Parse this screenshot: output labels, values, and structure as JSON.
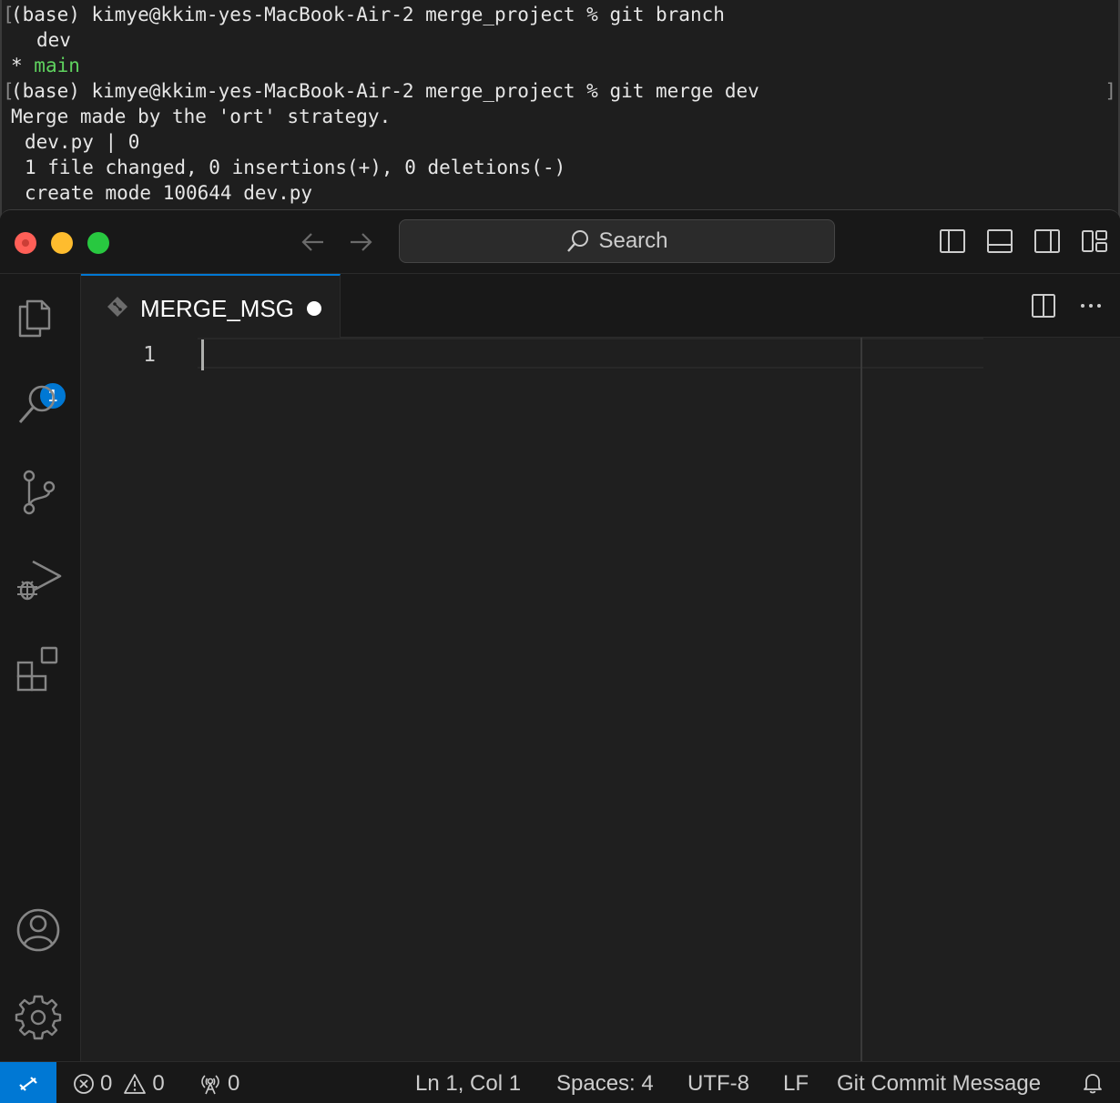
{
  "terminal": {
    "lines": [
      {
        "prompt": "(base) kimye@kkim-yes-MacBook-Air-2 merge_project % ",
        "command": "git branch"
      },
      {
        "text": "dev"
      },
      {
        "marker": "* ",
        "text": "main"
      },
      {
        "prompt": "(base) kimye@kkim-yes-MacBook-Air-2 merge_project % ",
        "command": "git merge dev"
      },
      {
        "text": "Merge made by the 'ort' strategy."
      },
      {
        "text": "dev.py | 0"
      },
      {
        "text": "1 file changed, 0 insertions(+), 0 deletions(-)"
      },
      {
        "text": "create mode 100644 dev.py"
      }
    ]
  },
  "titlebar": {
    "search_label": "Search"
  },
  "activity": {
    "explorer_badge": "1"
  },
  "tabs": [
    {
      "label": "MERGE_MSG",
      "dirty": true
    }
  ],
  "editor": {
    "line_numbers": [
      "1"
    ],
    "content": ""
  },
  "statusbar": {
    "errors": "0",
    "warnings": "0",
    "ports": "0",
    "cursor_position": "Ln 1, Col 1",
    "indentation": "Spaces: 4",
    "encoding": "UTF-8",
    "eol": "LF",
    "language": "Git Commit Message"
  },
  "colors": {
    "accent": "#0078d4",
    "terminal_green": "#5fd35f"
  }
}
